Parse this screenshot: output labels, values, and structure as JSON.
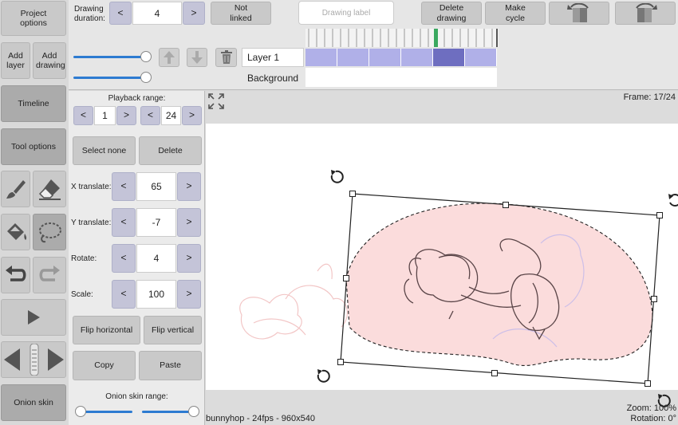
{
  "sidebar": {
    "project_options": "Project options",
    "add_layer": "Add layer",
    "add_drawing": "Add drawing",
    "timeline": "Timeline",
    "tool_options": "Tool options",
    "onion_skin": "Onion skin"
  },
  "toolbar": {
    "drawing_duration_label": "Drawing duration:",
    "drawing_duration_value": "4",
    "dec": "<",
    "inc": ">",
    "not_linked": "Not linked",
    "drawing_label_placeholder": "Drawing label",
    "delete_drawing": "Delete drawing",
    "make_cycle": "Make cycle"
  },
  "timeline": {
    "layer_name": "Layer 1",
    "background_label": "Background",
    "frame_cells": 6,
    "selected_cell": 4
  },
  "tool_panel": {
    "playback_range_label": "Playback range:",
    "playback_start": "1",
    "playback_end": "24",
    "select_none": "Select none",
    "delete": "Delete",
    "x_translate_label": "X translate:",
    "x_translate_value": "65",
    "y_translate_label": "Y translate:",
    "y_translate_value": "-7",
    "rotate_label": "Rotate:",
    "rotate_value": "4",
    "scale_label": "Scale:",
    "scale_value": "100",
    "flip_horizontal": "Flip horizontal",
    "flip_vertical": "Flip vertical",
    "copy": "Copy",
    "paste": "Paste",
    "onion_skin_range_label": "Onion skin range:"
  },
  "canvas": {
    "frame_readout": "Frame: 17/24",
    "project_info": "bunnyhop - 24fps - 960x540",
    "zoom": "Zoom: 100%",
    "rotation": "Rotation: 0°"
  },
  "colors": {
    "accent": "#2d7bd1",
    "stepper": "#c4c4d8",
    "frame_cell": "#b0b0e8",
    "frame_cell_selected": "#6e6ec0",
    "playhead": "#3aa860",
    "selection_fill": "#fbdcdc"
  },
  "icons": [
    "expand-icon",
    "brush-icon",
    "eraser-icon",
    "fill-bucket-icon",
    "lasso-icon",
    "undo-icon",
    "redo-icon",
    "play-icon",
    "prev-frame-icon",
    "scrub-handle-icon",
    "next-frame-icon",
    "move-layer-up-icon",
    "move-layer-down-icon",
    "trash-icon",
    "rotate-handle-icon",
    "flip-left-icon",
    "flip-right-icon"
  ]
}
